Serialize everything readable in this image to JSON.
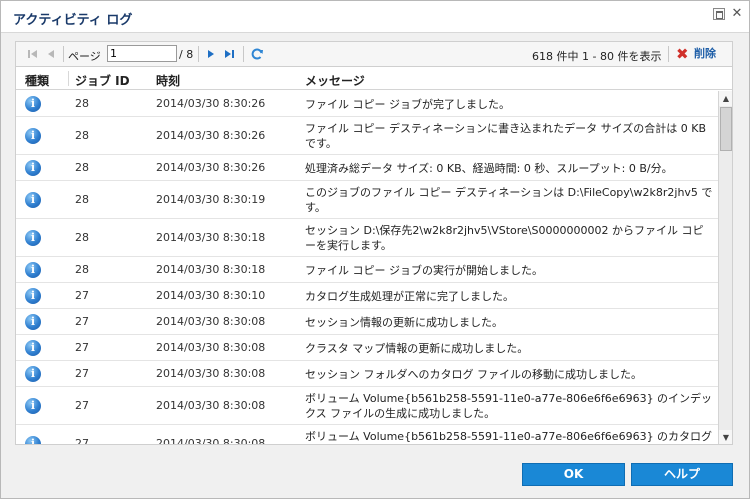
{
  "window": {
    "title": "アクティビティ ログ"
  },
  "toolbar": {
    "page_label": "ページ",
    "page_value": "1",
    "page_total": "/ 8",
    "count_text": "618 件中 1 - 80 件を表示",
    "delete_label": "削除"
  },
  "columns": {
    "type": "種類",
    "job_id": "ジョブ ID",
    "time": "時刻",
    "message": "メッセージ"
  },
  "rows": [
    {
      "type": "information-icon",
      "job_id": "28",
      "time": "2014/03/30 8:30:26",
      "message": "ファイル コピー ジョブが完了しました。"
    },
    {
      "type": "information-icon",
      "job_id": "28",
      "time": "2014/03/30 8:30:26",
      "message": "ファイル コピー デスティネーションに書き込まれたデータ サイズの合計は 0 KB です。"
    },
    {
      "type": "information-icon",
      "job_id": "28",
      "time": "2014/03/30 8:30:26",
      "message": "処理済み総データ サイズ: 0 KB、経過時間: 0 秒、スループット: 0 B/分。"
    },
    {
      "type": "information-icon",
      "job_id": "28",
      "time": "2014/03/30 8:30:19",
      "message": "このジョブのファイル コピー デスティネーションは D:\\FileCopy\\w2k8r2jhv5 です。"
    },
    {
      "type": "information-icon",
      "job_id": "28",
      "time": "2014/03/30 8:30:18",
      "message": "セッション D:\\保存先2\\w2k8r2jhv5\\VStore\\S0000000002 からファイル コピーを実行します。"
    },
    {
      "type": "information-icon",
      "job_id": "28",
      "time": "2014/03/30 8:30:18",
      "message": "ファイル コピー ジョブの実行が開始しました。"
    },
    {
      "type": "information-icon",
      "job_id": "27",
      "time": "2014/03/30 8:30:10",
      "message": "カタログ生成処理が正常に完了しました。"
    },
    {
      "type": "information-icon",
      "job_id": "27",
      "time": "2014/03/30 8:30:08",
      "message": "セッション情報の更新に成功しました。"
    },
    {
      "type": "information-icon",
      "job_id": "27",
      "time": "2014/03/30 8:30:08",
      "message": "クラスタ マップ情報の更新に成功しました。"
    },
    {
      "type": "information-icon",
      "job_id": "27",
      "time": "2014/03/30 8:30:08",
      "message": "セッション フォルダへのカタログ ファイルの移動に成功しました。"
    },
    {
      "type": "information-icon",
      "job_id": "27",
      "time": "2014/03/30 8:30:08",
      "message": "ボリューム Volume{b561b258-5591-11e0-a77e-806e6f6e6963} のインデックス ファイルの生成に成功しました。"
    },
    {
      "type": "information-icon",
      "job_id": "27",
      "time": "2014/03/30 8:30:08",
      "message": "ボリューム Volume{b561b258-5591-11e0-a77e-806e6f6e6963} のカタログ"
    }
  ],
  "buttons": {
    "ok": "OK",
    "help": "ヘルプ"
  },
  "colors": {
    "title_text": "#1a3a6a",
    "button_bg": "#1a88d6",
    "delete_text": "#1f5fa8",
    "delete_icon": "#d0302a"
  },
  "icons": {
    "first_page": "first-page-icon",
    "prev_page": "prev-page-icon",
    "next_page": "next-page-icon",
    "last_page": "last-page-icon",
    "refresh": "refresh-icon",
    "delete": "delete-x-icon",
    "info": "information-icon"
  }
}
